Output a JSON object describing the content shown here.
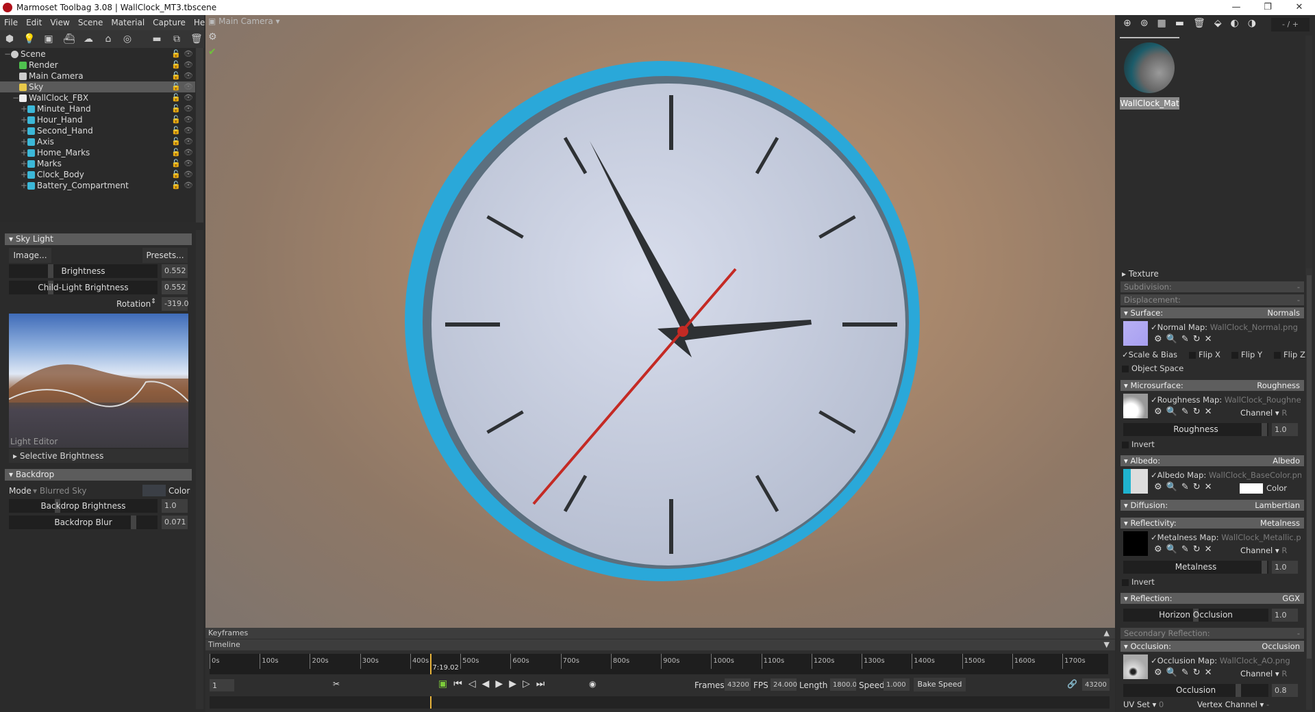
{
  "window": {
    "title": "Marmoset Toolbag 3.08  |  WallClock_MT3.tbscene",
    "controls": [
      "—",
      "❐",
      "✕"
    ]
  },
  "menu": [
    "File",
    "Edit",
    "View",
    "Scene",
    "Material",
    "Capture",
    "Help"
  ],
  "scene_tree": [
    {
      "label": "Scene",
      "depth": 0,
      "icon": "scene-icon",
      "color": "#cccccc"
    },
    {
      "label": "Render",
      "depth": 1,
      "icon": "render-gear-icon",
      "color": "#4fc24f"
    },
    {
      "label": "Main Camera",
      "depth": 1,
      "icon": "camera-icon",
      "color": "#cccccc"
    },
    {
      "label": "Sky",
      "depth": 1,
      "icon": "sky-icon",
      "color": "#e8c94a",
      "selected": true
    },
    {
      "label": "WallClock_FBX",
      "depth": 1,
      "icon": "fbx-file-icon",
      "color": "#eeeeee"
    },
    {
      "label": "Minute_Hand",
      "depth": 2,
      "icon": "mesh-cube-icon",
      "color": "#3cb8d8"
    },
    {
      "label": "Hour_Hand",
      "depth": 2,
      "icon": "mesh-cube-icon",
      "color": "#3cb8d8"
    },
    {
      "label": "Second_Hand",
      "depth": 2,
      "icon": "mesh-cube-icon",
      "color": "#3cb8d8"
    },
    {
      "label": "Axis",
      "depth": 2,
      "icon": "mesh-cube-icon",
      "color": "#3cb8d8"
    },
    {
      "label": "Home_Marks",
      "depth": 2,
      "icon": "mesh-cube-icon",
      "color": "#3cb8d8"
    },
    {
      "label": "Marks",
      "depth": 2,
      "icon": "mesh-cube-icon",
      "color": "#3cb8d8"
    },
    {
      "label": "Clock_Body",
      "depth": 2,
      "icon": "mesh-cube-icon",
      "color": "#3cb8d8"
    },
    {
      "label": "Battery_Compartment",
      "depth": 2,
      "icon": "mesh-cube-icon",
      "color": "#3cb8d8"
    }
  ],
  "sky_light": {
    "title": "Sky Light",
    "image_btn": "Image...",
    "presets_btn": "Presets...",
    "brightness_label": "Brightness",
    "brightness": "0.552",
    "child_label": "Child-Light Brightness",
    "child": "0.552",
    "rotation_label": "Rotation",
    "rotation": "-319.0",
    "light_editor": "Light Editor",
    "selective": "Selective Brightness"
  },
  "backdrop": {
    "title": "Backdrop",
    "mode_label": "Mode",
    "mode": "Blurred Sky",
    "color_label": "Color",
    "brightness_label": "Backdrop Brightness",
    "brightness": "1.0",
    "blur_label": "Backdrop Blur",
    "blur": "0.071"
  },
  "viewport": {
    "camera": "Main Camera"
  },
  "timeline": {
    "keyframes": "Keyframes",
    "timeline": "Timeline",
    "ticks": [
      "0s",
      "100s",
      "200s",
      "300s",
      "400s",
      "500s",
      "600s",
      "700s",
      "800s",
      "900s",
      "1000s",
      "1100s",
      "1200s",
      "1300s",
      "1400s",
      "1500s",
      "1600s",
      "1700s"
    ],
    "playhead_seconds": 439,
    "length_seconds": 1800,
    "playhead": "7:19.02",
    "frame": "1",
    "frames_label": "Frames",
    "frames": "43200",
    "fps_label": "FPS",
    "fps": "24.000",
    "length_label": "Length",
    "length": "1800.00",
    "speed_label": "Speed",
    "speed": "1.000",
    "bake": "Bake Speed",
    "end_frame": "43200"
  },
  "materials": {
    "counter": "- / +",
    "selected": "WallClock_Mat"
  },
  "material_props": {
    "texture": "Texture",
    "subdivision": "Subdivision:",
    "subdivision_val": "-",
    "displacement": "Displacement:",
    "displacement_val": "-",
    "surface": "Surface:",
    "surface_val": "Normals",
    "normal_map_label": "Normal Map:",
    "normal_map": "WallClock_Normal.png",
    "scale_bias": "Scale & Bias",
    "flip_x": "Flip X",
    "flip_y": "Flip Y",
    "flip_z": "Flip Z",
    "object_space": "Object Space",
    "microsurface": "Microsurface:",
    "microsurface_val": "Roughness",
    "roughness_map_label": "Roughness Map:",
    "roughness_map": "WallClock_Roughness.png",
    "channel": "Channel",
    "channel_val": "R",
    "roughness": "Roughness",
    "roughness_val": "1.0",
    "invert": "Invert",
    "albedo": "Albedo:",
    "albedo_val": "Albedo",
    "albedo_map_label": "Albedo Map:",
    "albedo_map": "WallClock_BaseColor.png",
    "color": "Color",
    "diffusion": "Diffusion:",
    "diffusion_val": "Lambertian",
    "reflectivity": "Reflectivity:",
    "reflectivity_val": "Metalness",
    "metal_map_label": "Metalness Map:",
    "metal_map": "WallClock_Metallic.png",
    "metalness": "Metalness",
    "metalness_val": "1.0",
    "reflection": "Reflection:",
    "reflection_val": "GGX",
    "horizon": "Horizon Occlusion",
    "horizon_val": "1.0",
    "secondary": "Secondary Reflection:",
    "secondary_val": "-",
    "occlusion": "Occlusion:",
    "occlusion_val": "Occlusion",
    "ao_map_label": "Occlusion Map:",
    "ao_map": "WallClock_AO.png",
    "occlusion_slider": "Occlusion",
    "occlusion_slider_val": "0.8",
    "uv_set": "UV Set",
    "uv_set_val": "0",
    "vertex_channel": "Vertex Channel",
    "vertex_channel_val": "-"
  },
  "colors": {
    "ring": "#2aa8d9",
    "face": "#cdd3e4",
    "hand": "#2e3134",
    "second": "#c42a24"
  }
}
